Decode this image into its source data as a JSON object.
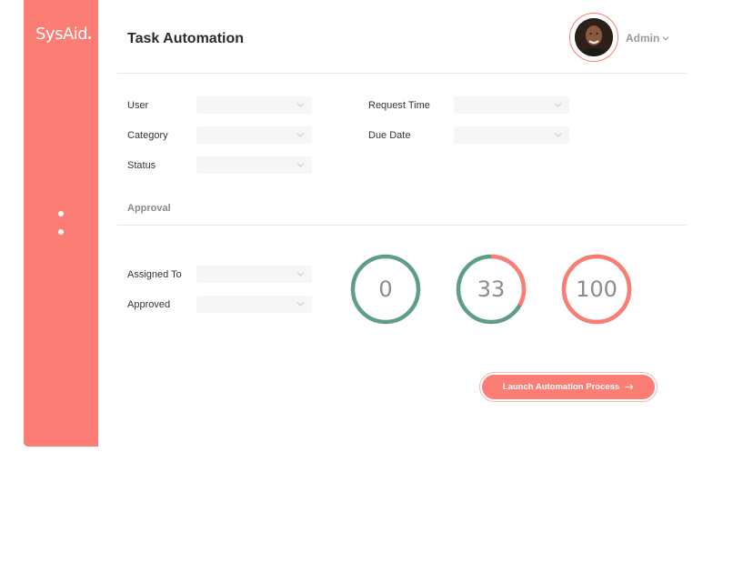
{
  "app": {
    "logo_text": "SysAid"
  },
  "header": {
    "title": "Task Automation",
    "user_label": "Admin"
  },
  "filters": {
    "user": {
      "label": "User",
      "value": ""
    },
    "category": {
      "label": "Category",
      "value": ""
    },
    "status": {
      "label": "Status",
      "value": ""
    },
    "request_time": {
      "label": "Request Time",
      "value": ""
    },
    "due_date": {
      "label": "Due Date",
      "value": ""
    }
  },
  "approval": {
    "section_title": "Approval",
    "assigned_to": {
      "label": "Assigned To",
      "value": ""
    },
    "approved": {
      "label": "Approved",
      "value": ""
    }
  },
  "gauges": [
    {
      "value": "0",
      "percent": 0
    },
    {
      "value": "33",
      "percent": 33
    },
    {
      "value": "100",
      "percent": 100
    }
  ],
  "actions": {
    "launch_label": "Launch Automation Process"
  },
  "colors": {
    "accent": "#fb7d74",
    "green": "#5e9e86",
    "text": "#2b2b2b",
    "muted": "#9a9a9a"
  },
  "icons": {
    "dropdown": "chevron-down-icon",
    "launch": "arrow-right-icon"
  }
}
